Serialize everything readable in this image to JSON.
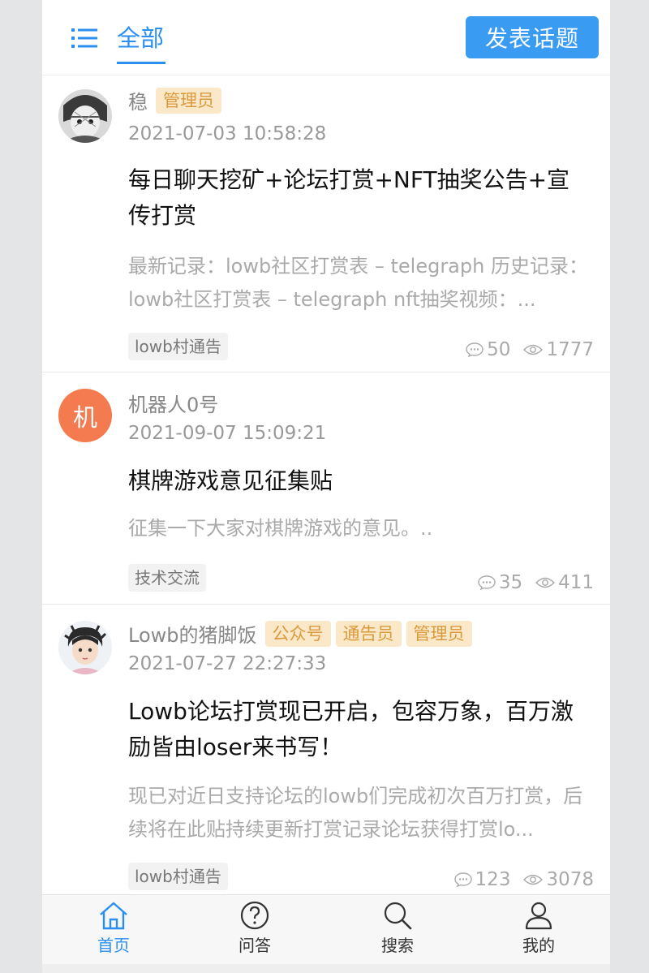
{
  "header": {
    "tab_label": "全部",
    "post_button": "发表话题"
  },
  "posts": [
    {
      "author": "稳",
      "badges": [
        "管理员"
      ],
      "time": "2021-07-03 10:58:28",
      "title": "每日聊天挖矿+论坛打赏+NFT抽奖公告+宣传打赏",
      "excerpt": "最新记录：lowb社区打赏表 – telegraph 历史记录：lowb社区打赏表 – telegraph nft抽奖视频：...",
      "tag": "lowb村通告",
      "comments": "50",
      "views": "1777"
    },
    {
      "author": "机器人0号",
      "avatar_text": "机",
      "badges": [],
      "time": "2021-09-07 15:09:21",
      "title": "棋牌游戏意见征集贴",
      "excerpt": "征集一下大家对棋牌游戏的意见。..",
      "tag": "技术交流",
      "comments": "35",
      "views": "411"
    },
    {
      "author": "Lowb的猪脚饭",
      "badges": [
        "公众号",
        "通告员",
        "管理员"
      ],
      "time": "2021-07-27 22:27:33",
      "title": "Lowb论坛打赏现已开启，包容万象，百万激励皆由loser来书写！",
      "excerpt": "现已对近日支持论坛的lowb们完成初次百万打赏，后续将在此贴持续更新打赏记录论坛获得打赏lo...",
      "tag": "lowb村通告",
      "comments": "123",
      "views": "3078"
    }
  ],
  "nav": [
    {
      "label": "首页",
      "icon": "home-icon"
    },
    {
      "label": "问答",
      "icon": "question-icon"
    },
    {
      "label": "搜索",
      "icon": "search-icon"
    },
    {
      "label": "我的",
      "icon": "user-icon"
    }
  ],
  "colors": {
    "accent": "#2b8ff2",
    "badge_bg": "#fbe8c9",
    "badge_text": "#d99a3c",
    "robot_avatar": "#f47b4f"
  }
}
